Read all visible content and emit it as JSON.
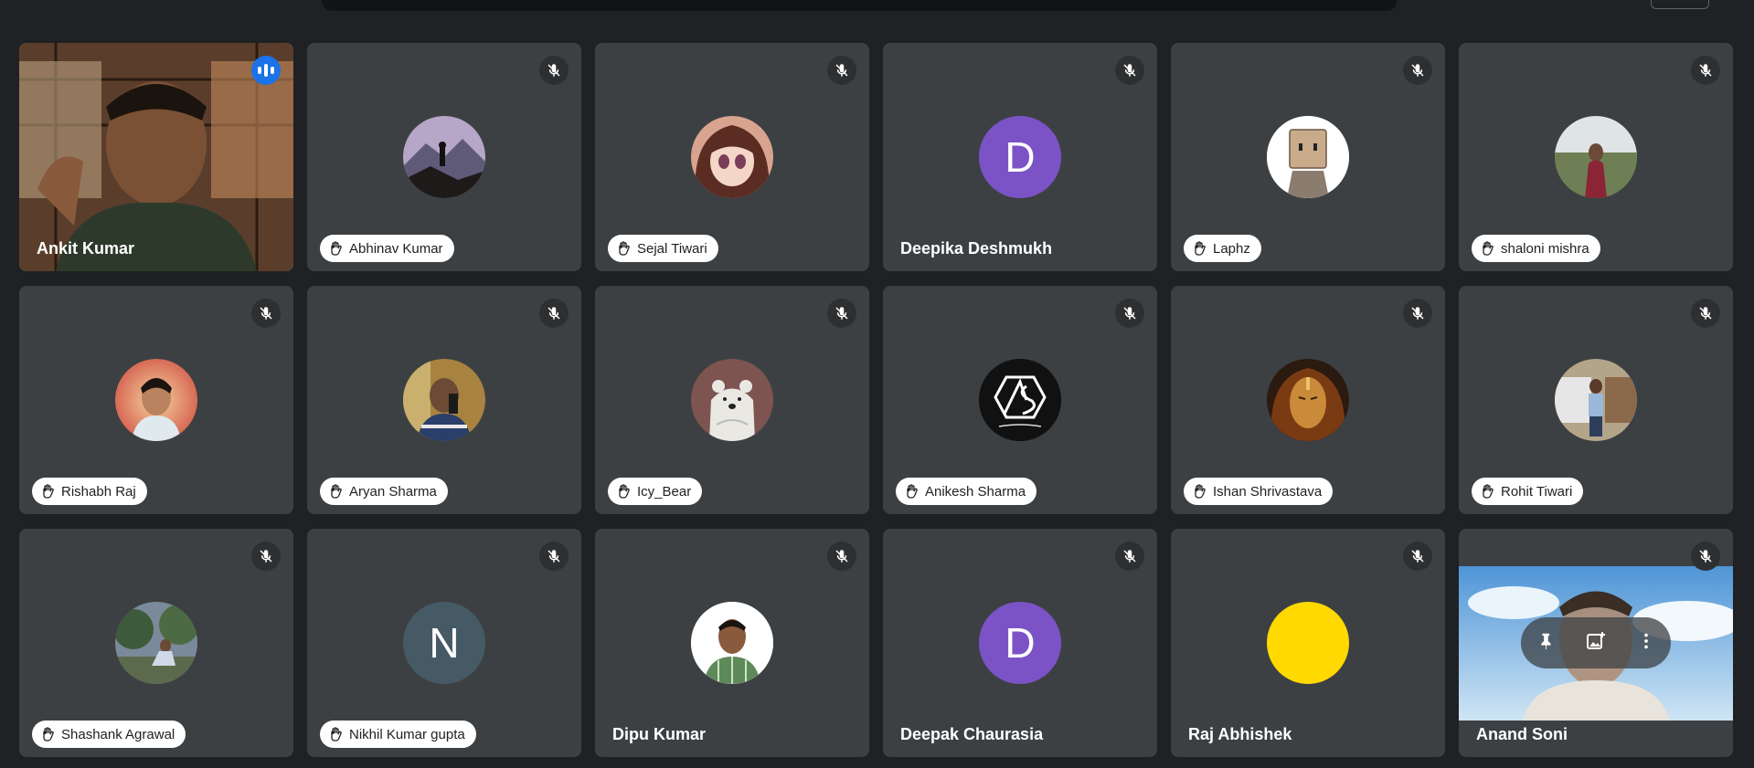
{
  "participants": [
    {
      "name": "Ankit Kumar",
      "type": "video",
      "speaking": true,
      "hand": false
    },
    {
      "name": "Abhinav Kumar",
      "type": "photo",
      "avatar": "mountain-hiker",
      "hand": true
    },
    {
      "name": "Sejal Tiwari",
      "type": "photo",
      "avatar": "anime-girl",
      "hand": true
    },
    {
      "name": "Deepika Deshmukh",
      "type": "letter",
      "letter": "D",
      "color": "#7b53c6",
      "hand": false
    },
    {
      "name": "Laphz",
      "type": "photo",
      "avatar": "paper-bag-character",
      "hand": true
    },
    {
      "name": "shaloni mishra",
      "type": "photo",
      "avatar": "woman-outdoors",
      "hand": true
    },
    {
      "name": "Rishabh Raj",
      "type": "photo",
      "avatar": "man-portrait",
      "hand": true
    },
    {
      "name": "Aryan Sharma",
      "type": "photo",
      "avatar": "mirror-selfie",
      "hand": true
    },
    {
      "name": "Icy_Bear",
      "type": "photo",
      "avatar": "polar-bear",
      "hand": true
    },
    {
      "name": "Anikesh Sharma",
      "type": "photo",
      "avatar": "as-logo",
      "hand": true
    },
    {
      "name": "Ishan Shrivastava",
      "type": "photo",
      "avatar": "golden-face",
      "hand": true
    },
    {
      "name": "Rohit Tiwari",
      "type": "photo",
      "avatar": "man-with-truck",
      "hand": true
    },
    {
      "name": "Shashank Agrawal",
      "type": "photo",
      "avatar": "man-in-garden",
      "hand": true
    },
    {
      "name": "Nikhil Kumar gupta",
      "type": "letter",
      "letter": "N",
      "color": "#455a64",
      "hand": true
    },
    {
      "name": "Dipu Kumar",
      "type": "photo",
      "avatar": "man-checkered-shirt",
      "hand": false
    },
    {
      "name": "Deepak Chaurasia",
      "type": "letter",
      "letter": "D",
      "color": "#7b53c6",
      "hand": false
    },
    {
      "name": "Raj Abhishek",
      "type": "photo",
      "avatar": "yellow-circle",
      "hand": false
    },
    {
      "name": "Anand Soni",
      "type": "video",
      "speaking": false,
      "hand": false,
      "hovered": true
    }
  ],
  "colors": {
    "background": "#202124",
    "tile": "#3c4043",
    "speaking_outline": "#8ab4f8",
    "accent": "#1a73e8"
  }
}
